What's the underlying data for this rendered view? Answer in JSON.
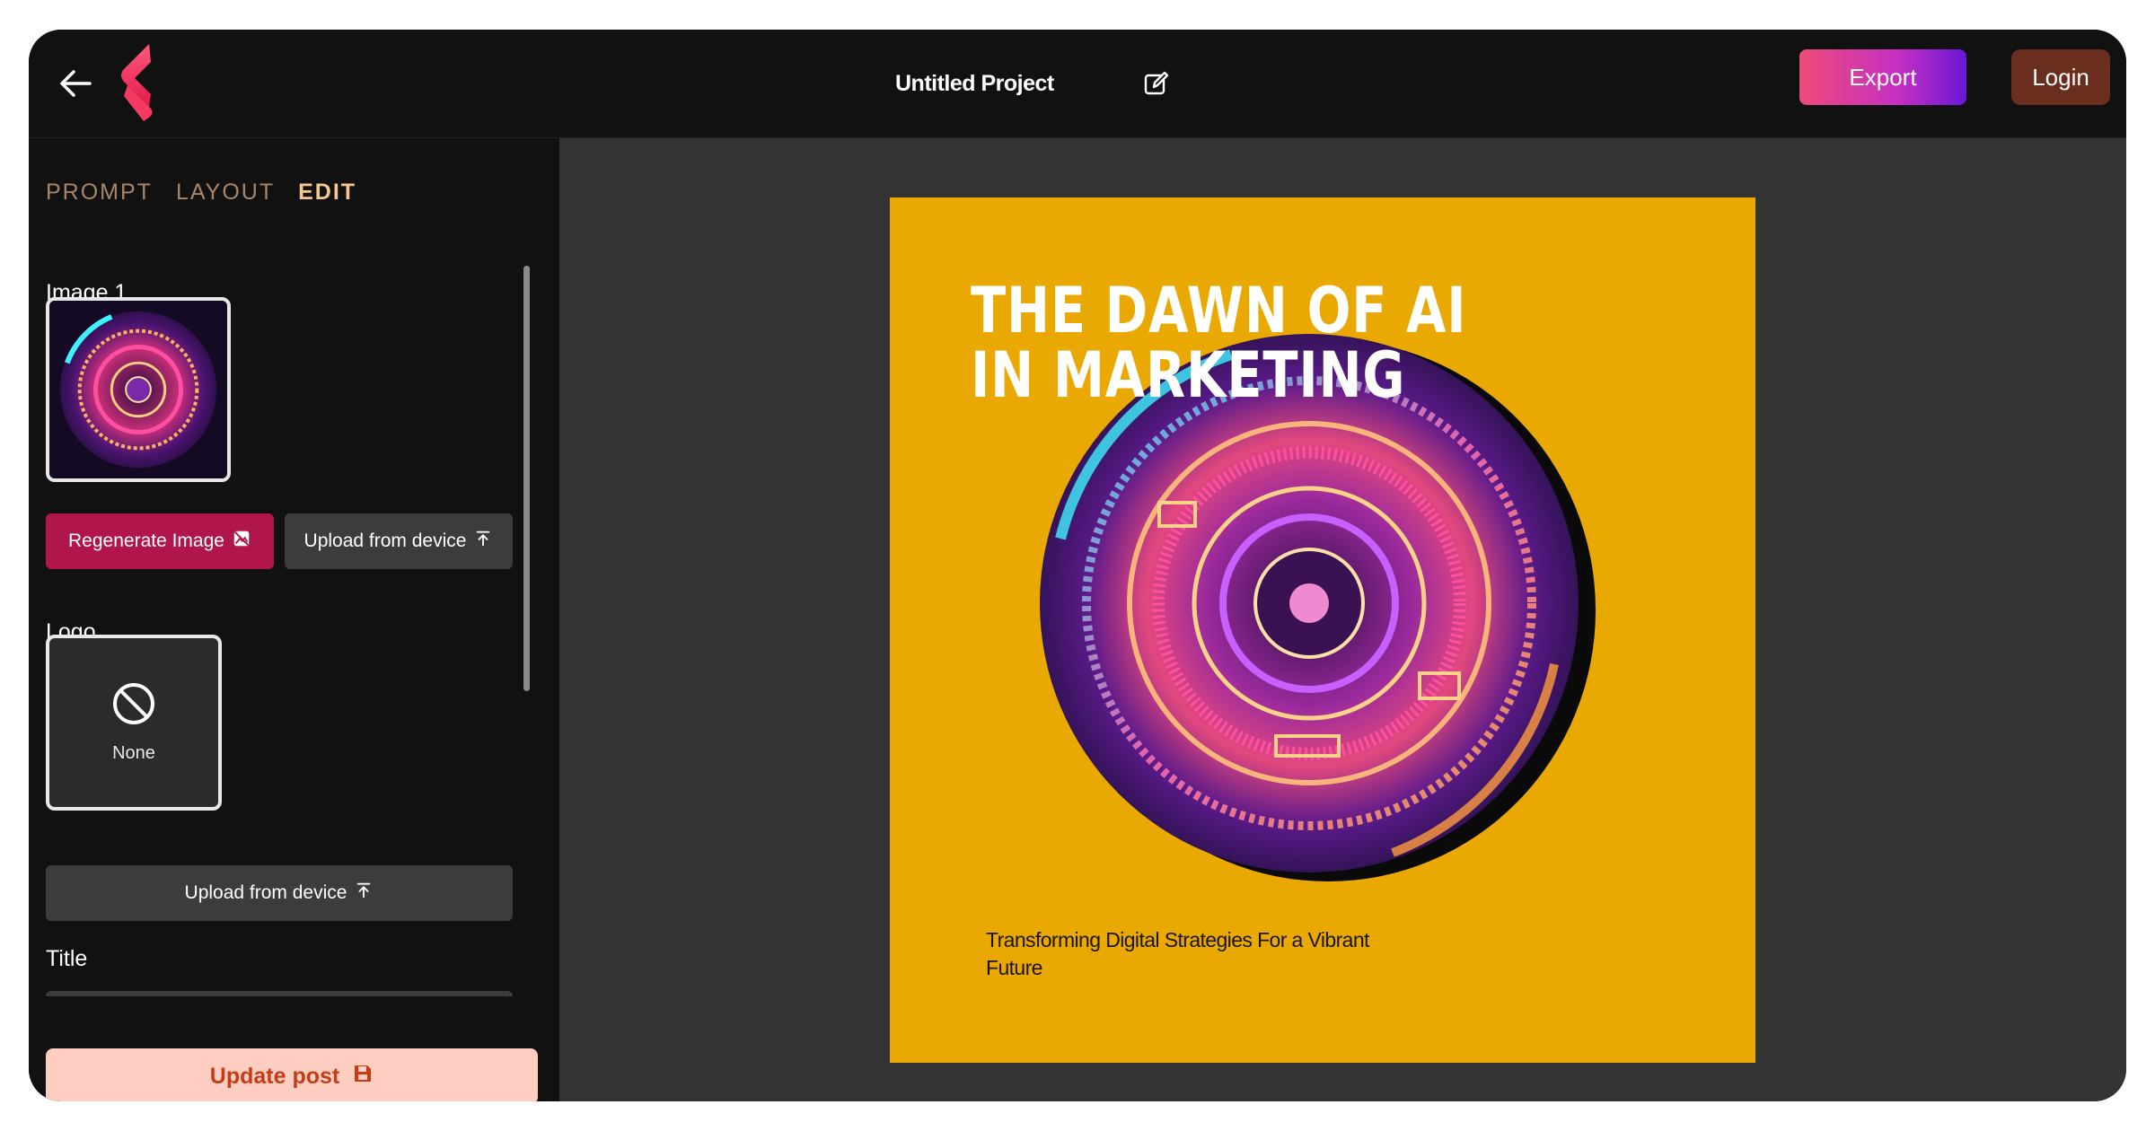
{
  "header": {
    "project_title": "Untitled Project",
    "export_label": "Export",
    "login_label": "Login"
  },
  "sidebar": {
    "tabs": [
      {
        "label": "PROMPT",
        "active": false
      },
      {
        "label": "LAYOUT",
        "active": false
      },
      {
        "label": "EDIT",
        "active": true
      }
    ],
    "image_section_label": "Image 1",
    "regenerate_label": "Regenerate Image",
    "upload_label": "Upload from device",
    "logo_section_label": "Logo",
    "logo_none_label": "None",
    "logo_upload_label": "Upload from device",
    "title_section_label": "Title",
    "update_label": "Update post"
  },
  "post": {
    "title_line1": "THE DAWN OF AI",
    "title_line2": "IN MARKETING",
    "subtitle": "Transforming Digital Strategies For a Vibrant Future",
    "background_color": "#e9a902"
  },
  "colors": {
    "accent_export_start": "#ef4b79",
    "accent_export_end": "#6a17d6",
    "login_bg": "#6a2e1f",
    "regenerate_bg": "#b0164b",
    "update_bg": "#ffcec1",
    "update_text": "#c23d18",
    "active_tab": "#f4c792"
  },
  "icons": {
    "back": "arrow-left-icon",
    "brand": "brand-logo-icon",
    "edit": "edit-pencil-icon",
    "regenerate": "image-regenerate-icon",
    "upload": "upload-arrow-icon",
    "none": "ban-icon",
    "save": "floppy-save-icon"
  }
}
